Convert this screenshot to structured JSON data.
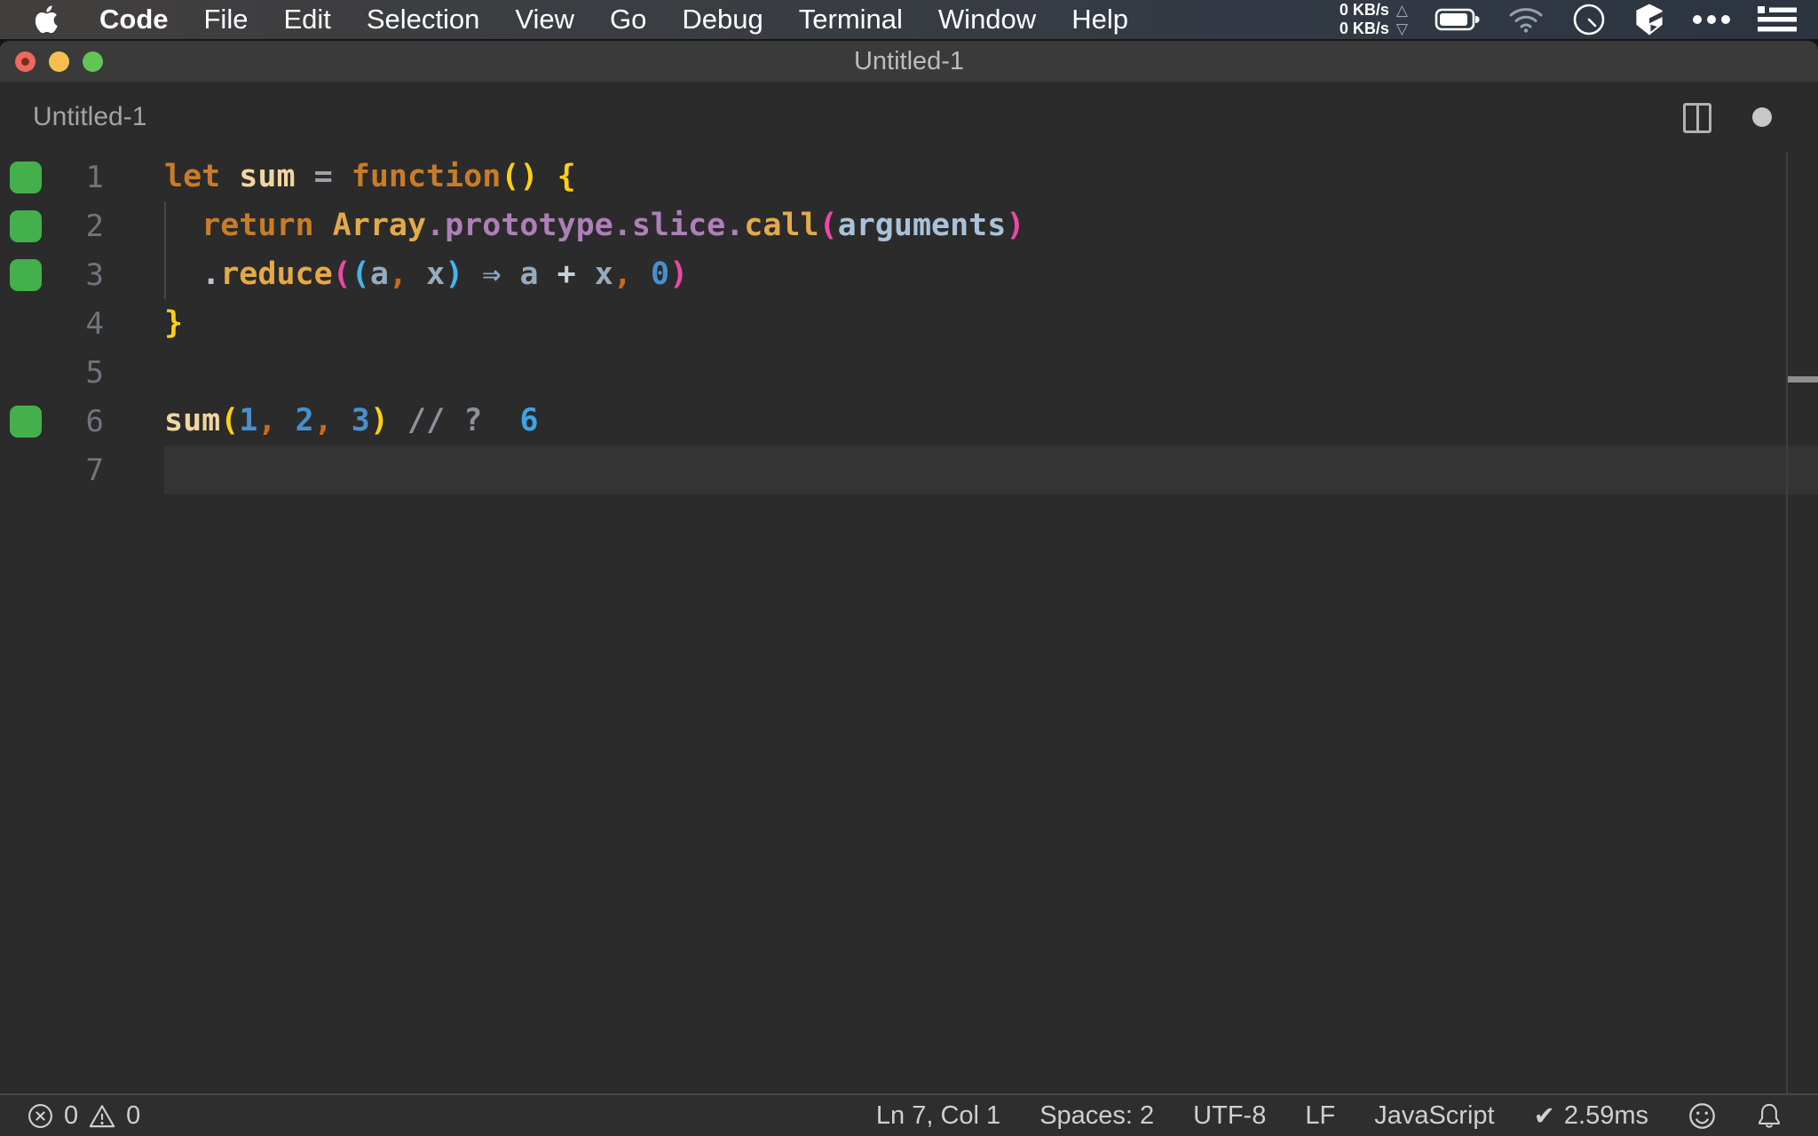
{
  "menubar": {
    "items": [
      "Code",
      "File",
      "Edit",
      "Selection",
      "View",
      "Go",
      "Debug",
      "Terminal",
      "Window",
      "Help"
    ],
    "network": {
      "up_value": "0 KB/s",
      "up_symbol": "△",
      "down_value": "0 KB/s",
      "down_symbol": "▽"
    }
  },
  "window": {
    "title": "Untitled-1"
  },
  "editor_header": {
    "label": "Untitled-1"
  },
  "editor": {
    "lines": [
      {
        "num": 1,
        "coverage": true,
        "current": false,
        "tokens": [
          [
            "let",
            "keyword"
          ],
          [
            " ",
            ""
          ],
          [
            "sum",
            "variable"
          ],
          [
            " ",
            ""
          ],
          [
            "=",
            "operator"
          ],
          [
            " ",
            ""
          ],
          [
            "function",
            "keyword"
          ],
          [
            "(",
            "bracket1"
          ],
          [
            ")",
            "bracket1"
          ],
          [
            " ",
            ""
          ],
          [
            "{",
            "bracket1"
          ]
        ]
      },
      {
        "num": 2,
        "coverage": true,
        "current": false,
        "tokens": [
          [
            "  ",
            ""
          ],
          [
            "return",
            "keyword"
          ],
          [
            " ",
            ""
          ],
          [
            "Array",
            "classname"
          ],
          [
            ".",
            "property"
          ],
          [
            "prototype",
            "property"
          ],
          [
            ".",
            "property"
          ],
          [
            "slice",
            "property"
          ],
          [
            ".",
            "property"
          ],
          [
            "call",
            "function"
          ],
          [
            "(",
            "bracket2"
          ],
          [
            "arguments",
            "argument"
          ],
          [
            ")",
            "bracket2"
          ]
        ]
      },
      {
        "num": 3,
        "coverage": true,
        "current": false,
        "tokens": [
          [
            "  ",
            ""
          ],
          [
            ".",
            "punct"
          ],
          [
            "reduce",
            "function"
          ],
          [
            "(",
            "bracket2"
          ],
          [
            "(",
            "bracket3"
          ],
          [
            "a",
            "param"
          ],
          [
            ",",
            "comma"
          ],
          [
            " ",
            ""
          ],
          [
            "x",
            "param"
          ],
          [
            ")",
            "bracket3"
          ],
          [
            " ",
            ""
          ],
          [
            "⇒",
            "arrow"
          ],
          [
            " ",
            ""
          ],
          [
            "a",
            "param"
          ],
          [
            " ",
            ""
          ],
          [
            "+",
            "operatorLight"
          ],
          [
            " ",
            ""
          ],
          [
            "x",
            "param"
          ],
          [
            ",",
            "comma"
          ],
          [
            " ",
            ""
          ],
          [
            "0",
            "number"
          ],
          [
            ")",
            "bracket2"
          ]
        ]
      },
      {
        "num": 4,
        "coverage": false,
        "current": false,
        "tokens": [
          [
            "}",
            "bracket1"
          ]
        ]
      },
      {
        "num": 5,
        "coverage": false,
        "current": false,
        "tokens": []
      },
      {
        "num": 6,
        "coverage": true,
        "current": false,
        "tokens": [
          [
            "sum",
            "variable"
          ],
          [
            "(",
            "bracket1"
          ],
          [
            "1",
            "number"
          ],
          [
            ",",
            "comma"
          ],
          [
            " ",
            ""
          ],
          [
            "2",
            "number"
          ],
          [
            ",",
            "comma"
          ],
          [
            " ",
            ""
          ],
          [
            "3",
            "number"
          ],
          [
            ")",
            "bracket1"
          ],
          [
            " ",
            ""
          ],
          [
            "//",
            "comment"
          ],
          [
            " ",
            ""
          ],
          [
            "?",
            "comment"
          ],
          [
            "  ",
            ""
          ],
          [
            "6",
            "quokkaValue"
          ]
        ]
      },
      {
        "num": 7,
        "coverage": false,
        "current": true,
        "tokens": []
      }
    ]
  },
  "colors": {
    "keyword": "#c97c28",
    "variable": "#f1d6a0",
    "classname": "#e3aa48",
    "function": "#e3aa48",
    "property": "#ae7fb8",
    "argument": "#a9c2d8",
    "param": "#97abbe",
    "operator": "#9ba1a8",
    "operatorLight": "#cbd0d6",
    "punct": "#bac7d3",
    "arrow": "#8ea8c4",
    "comma": "#cb6a1d",
    "number": "#4a8fce",
    "bracket1": "#fdd014",
    "bracket2": "#ec49a6",
    "bracket3": "#47b3ee",
    "comment": "#8b929b",
    "quokkaValue": "#3ea2e5",
    "coverage_green": "#43b04c"
  },
  "statusbar": {
    "errors": "0",
    "warnings": "0",
    "position": "Ln 7, Col 1",
    "indentation": "Spaces: 2",
    "encoding": "UTF-8",
    "eol": "LF",
    "language": "JavaScript",
    "quokka_check": "✔",
    "quokka_time": "2.59ms"
  },
  "icons": {
    "menubar_right": [
      "battery-icon",
      "wifi-icon",
      "clock-icon",
      "cube-icon",
      "ellipsis-icon",
      "list-icon"
    ],
    "statusbar_left": [
      "error-icon",
      "warning-icon"
    ],
    "statusbar_right": [
      "smiley-icon",
      "bell-icon"
    ]
  }
}
